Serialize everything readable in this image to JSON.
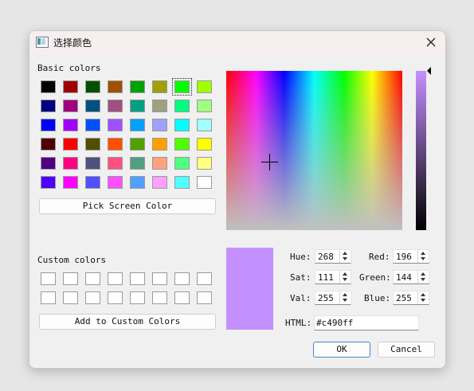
{
  "window": {
    "title": "选择颜色"
  },
  "basic_colors": {
    "label": "Basic colors",
    "swatches": [
      "#000000",
      "#a00000",
      "#005000",
      "#a05000",
      "#00a000",
      "#a0a000",
      "#00ff00",
      "#a0ff00",
      "#000080",
      "#a00080",
      "#005080",
      "#a05080",
      "#00a080",
      "#a0a080",
      "#00ff80",
      "#a0ff80",
      "#0000ff",
      "#a000ff",
      "#0050ff",
      "#a050ff",
      "#00a0ff",
      "#a0a0ff",
      "#00ffff",
      "#a0ffff",
      "#500000",
      "#ff0000",
      "#505000",
      "#ff5000",
      "#50a000",
      "#ffa000",
      "#50ff00",
      "#ffff00",
      "#500080",
      "#ff0080",
      "#505080",
      "#ff5080",
      "#50a080",
      "#ffa080",
      "#50ff80",
      "#ffff80",
      "#5000ff",
      "#ff00ff",
      "#5050ff",
      "#ff50ff",
      "#50a0ff",
      "#ffa0ff",
      "#50ffff",
      "#ffffff"
    ],
    "selected_index": 6
  },
  "pick_screen_color_label": "Pick Screen Color",
  "custom_colors": {
    "label": "Custom colors",
    "count": 16
  },
  "add_custom_label": "Add to Custom Colors",
  "current_color": "#c490ff",
  "fields": {
    "hue": {
      "label": "Hue:",
      "value": "268"
    },
    "sat": {
      "label": "Sat:",
      "value": "111"
    },
    "val": {
      "label": "Val:",
      "value": "255"
    },
    "red": {
      "label": "Red:",
      "value": "196"
    },
    "green": {
      "label": "Green:",
      "value": "144"
    },
    "blue": {
      "label": "Blue:",
      "value": "255"
    },
    "html": {
      "label": "HTML:",
      "value": "#c490ff"
    }
  },
  "buttons": {
    "ok": "OK",
    "cancel": "Cancel"
  }
}
